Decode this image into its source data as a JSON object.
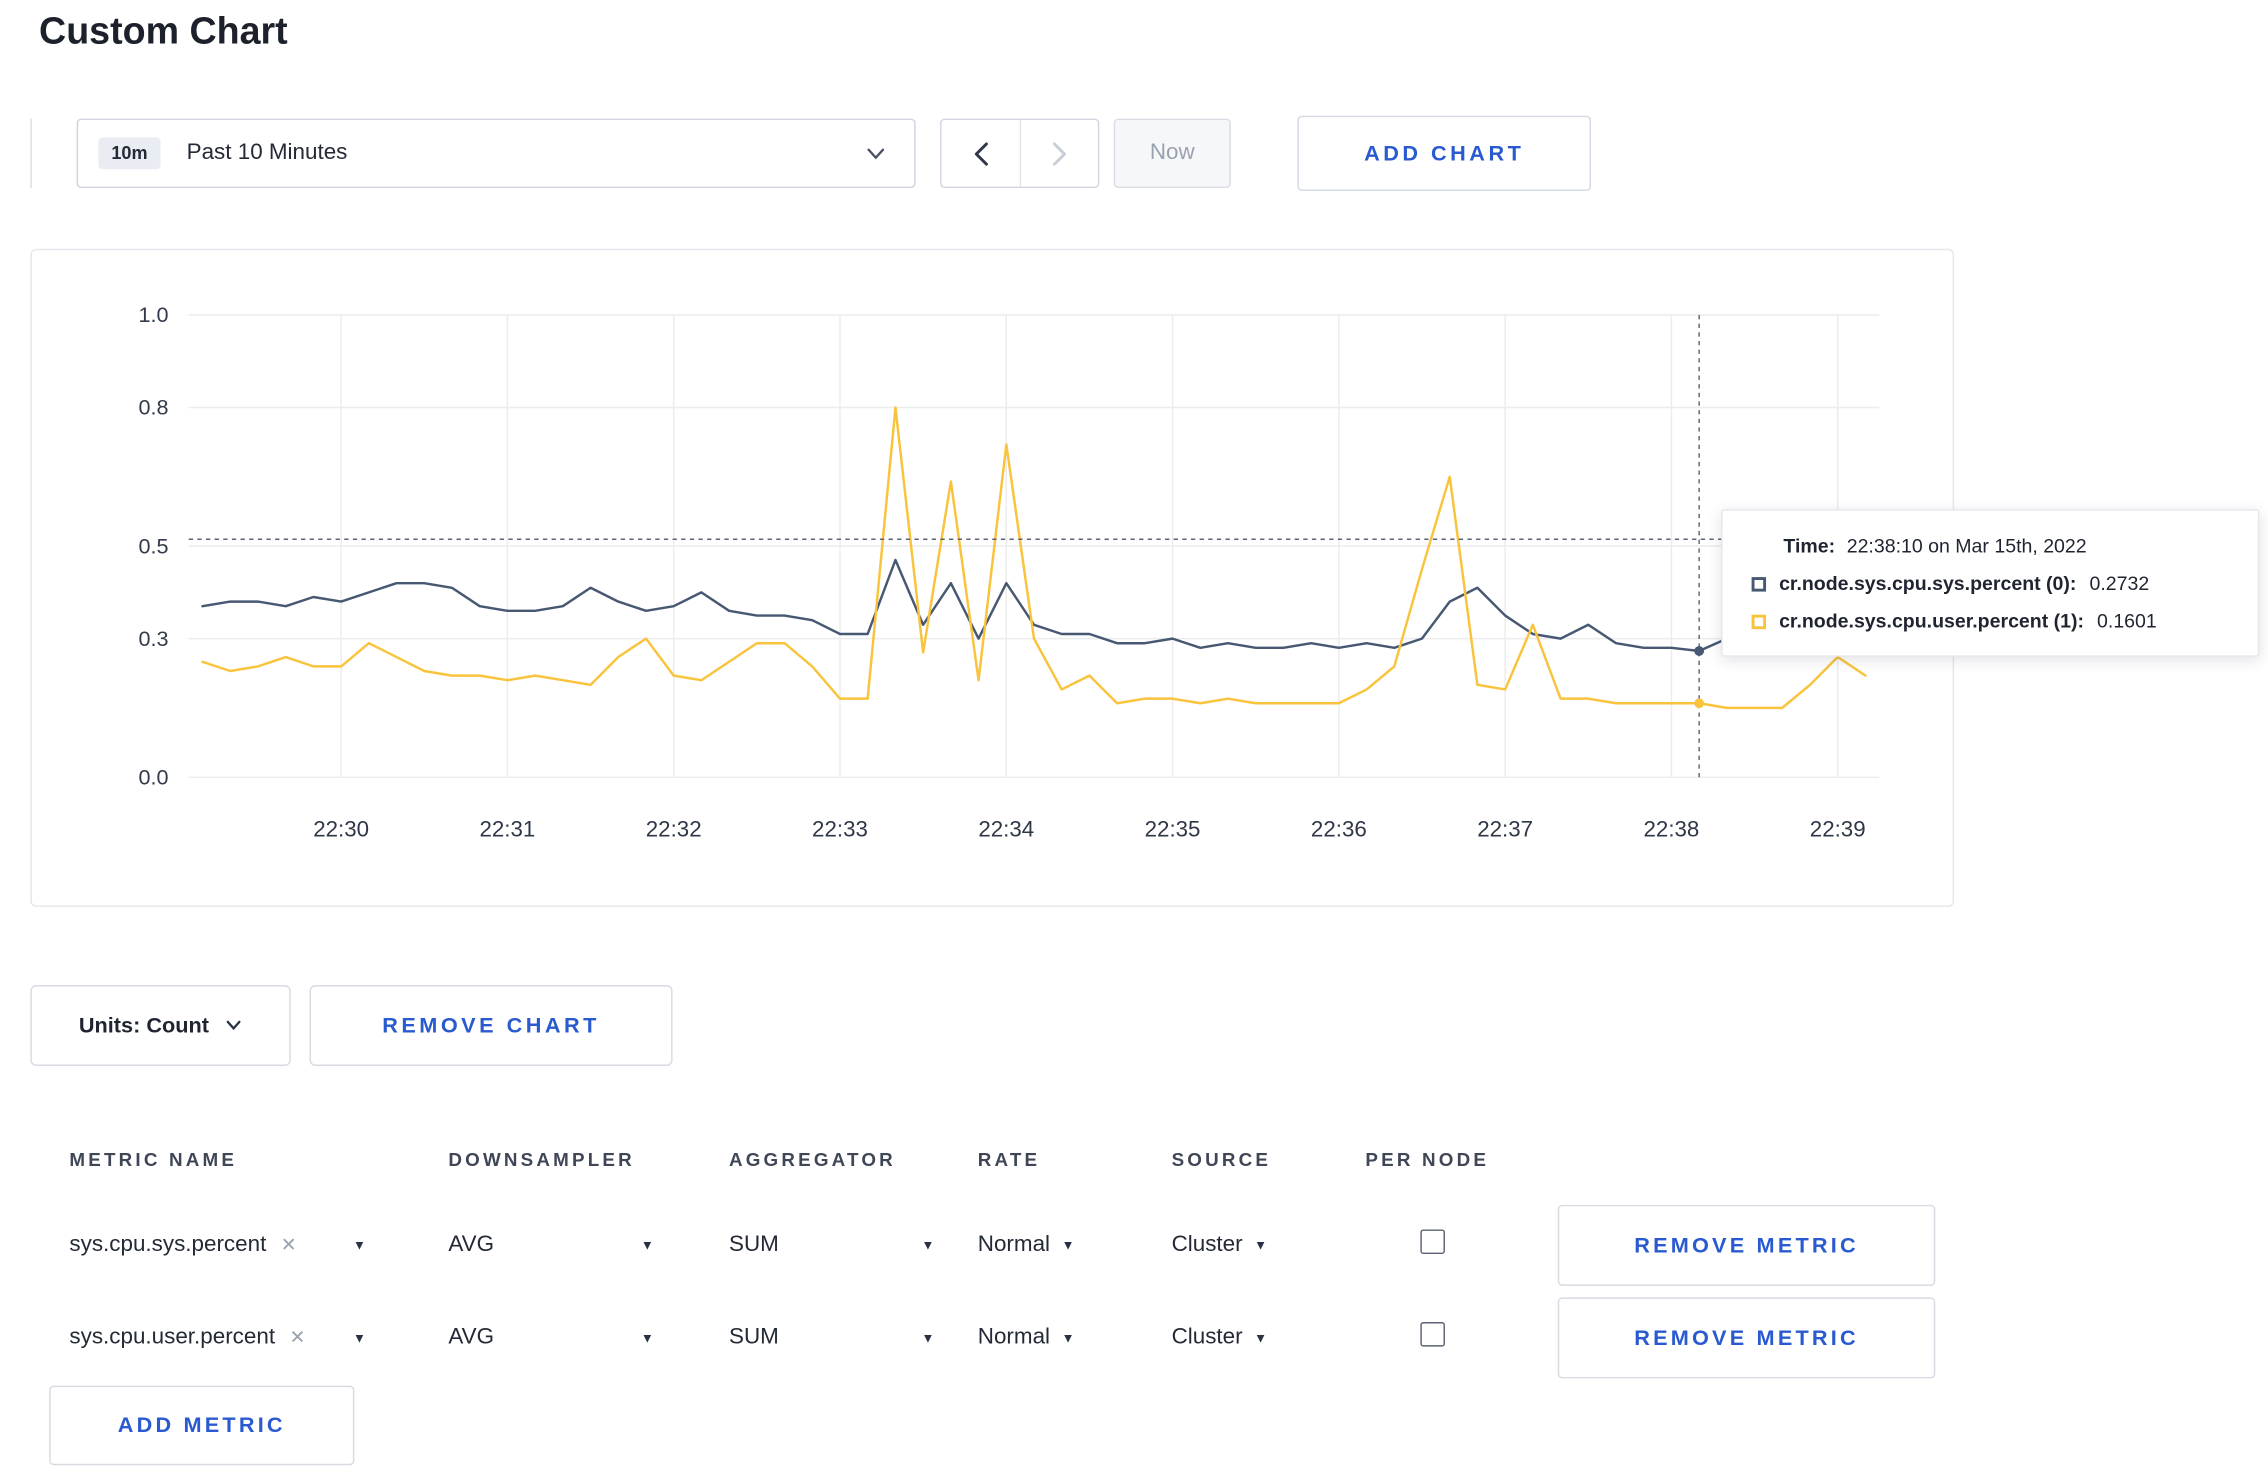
{
  "colors": {
    "accent": "#2A5AD0"
  },
  "page": {
    "title": "Custom Chart"
  },
  "toolbar": {
    "range_badge": "10m",
    "range_label": "Past 10 Minutes",
    "now_label": "Now",
    "add_chart_label": "ADD CHART"
  },
  "chart_controls": {
    "units_label": "Units: Count",
    "remove_chart_label": "REMOVE CHART"
  },
  "tooltip": {
    "time_label": "Time:",
    "time_value": "22:38:10 on Mar 15th, 2022",
    "rows": [
      {
        "name": "cr.node.sys.cpu.sys.percent (0):",
        "value": "0.2732",
        "color": "#475872"
      },
      {
        "name": "cr.node.sys.cpu.user.percent (1):",
        "value": "0.1601",
        "color": "#F9C33C"
      }
    ]
  },
  "chart_data": {
    "type": "line",
    "title": "Custom Chart",
    "ylim": [
      0,
      1
    ],
    "grid": true,
    "y_ticks": [
      {
        "label": "1.0",
        "value": 1.0
      },
      {
        "label": "0.8",
        "value": 0.8
      },
      {
        "label": "0.5",
        "value": 0.5
      },
      {
        "label": "0.3",
        "value": 0.3
      },
      {
        "label": "0.0",
        "value": 0.0
      }
    ],
    "x_ticks": [
      "22:30",
      "22:31",
      "22:32",
      "22:33",
      "22:34",
      "22:35",
      "22:36",
      "22:37",
      "22:38",
      "22:39"
    ],
    "x_window": {
      "start": "22:29:05",
      "end": "22:39:15"
    },
    "points_start": "22:29:10",
    "points_step_seconds": 10,
    "series": [
      {
        "name": "cr.node.sys.cpu.sys.percent (0)",
        "color": "#475872",
        "values": [
          0.37,
          0.38,
          0.38,
          0.37,
          0.39,
          0.38,
          0.4,
          0.42,
          0.42,
          0.41,
          0.37,
          0.36,
          0.36,
          0.37,
          0.41,
          0.38,
          0.36,
          0.37,
          0.4,
          0.36,
          0.35,
          0.35,
          0.34,
          0.31,
          0.31,
          0.47,
          0.33,
          0.42,
          0.3,
          0.42,
          0.33,
          0.31,
          0.31,
          0.29,
          0.29,
          0.3,
          0.28,
          0.29,
          0.28,
          0.28,
          0.29,
          0.28,
          0.29,
          0.28,
          0.3,
          0.38,
          0.41,
          0.35,
          0.31,
          0.3,
          0.33,
          0.29,
          0.28,
          0.28,
          0.2732,
          0.3,
          0.31,
          0.3,
          0.3,
          0.31,
          0.29
        ]
      },
      {
        "name": "cr.node.sys.cpu.user.percent (1)",
        "color": "#F9C33C",
        "values": [
          0.25,
          0.23,
          0.24,
          0.26,
          0.24,
          0.24,
          0.29,
          0.26,
          0.23,
          0.22,
          0.22,
          0.21,
          0.22,
          0.21,
          0.2,
          0.26,
          0.3,
          0.22,
          0.21,
          0.25,
          0.29,
          0.29,
          0.24,
          0.17,
          0.17,
          0.8,
          0.27,
          0.64,
          0.21,
          0.72,
          0.3,
          0.19,
          0.22,
          0.16,
          0.17,
          0.17,
          0.16,
          0.17,
          0.16,
          0.16,
          0.16,
          0.16,
          0.19,
          0.24,
          0.45,
          0.65,
          0.2,
          0.19,
          0.33,
          0.17,
          0.17,
          0.16,
          0.16,
          0.16,
          0.1601,
          0.15,
          0.15,
          0.15,
          0.2,
          0.26,
          0.22
        ]
      }
    ],
    "crosshair": {
      "time": "22:38:10",
      "hover_value": 0.515,
      "points": [
        {
          "series": 0,
          "value": 0.2732
        },
        {
          "series": 1,
          "value": 0.1601
        }
      ]
    }
  },
  "metrics_table": {
    "headers": [
      "METRIC NAME",
      "DOWNSAMPLER",
      "AGGREGATOR",
      "RATE",
      "SOURCE",
      "PER NODE"
    ],
    "rows": [
      {
        "metric": "sys.cpu.sys.percent",
        "downsampler": "AVG",
        "aggregator": "SUM",
        "rate": "Normal",
        "source": "Cluster",
        "per_node": false,
        "remove_label": "REMOVE METRIC"
      },
      {
        "metric": "sys.cpu.user.percent",
        "downsampler": "AVG",
        "aggregator": "SUM",
        "rate": "Normal",
        "source": "Cluster",
        "per_node": false,
        "remove_label": "REMOVE METRIC"
      }
    ],
    "add_metric_label": "ADD METRIC"
  }
}
